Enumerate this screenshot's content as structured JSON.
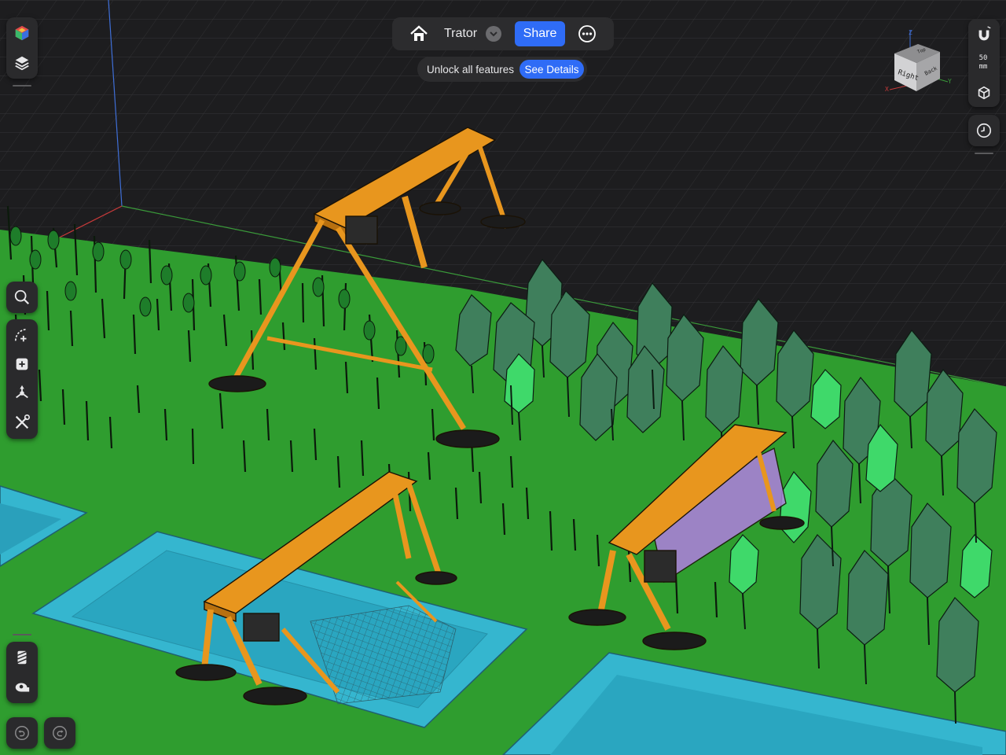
{
  "app": {
    "document_title": "Trator",
    "share_label": "Share",
    "promo_text": "Unlock all features",
    "promo_button": "See Details"
  },
  "view_cube": {
    "faces": {
      "right": "Right",
      "back": "Back",
      "top": "Top"
    },
    "axes": {
      "x": "X",
      "y": "Y",
      "z": "Z"
    }
  },
  "snap": {
    "value": "50",
    "unit": "mm"
  },
  "left_toolbar_icons": [
    "material-cube-icon",
    "layers-icon",
    "search-icon",
    "sketch-curve-icon",
    "add-primitive-icon",
    "transform-gizmo-icon",
    "tools-icon",
    "section-view-icon",
    "measure-tape-icon",
    "undo-icon",
    "redo-icon"
  ],
  "right_toolbar_icons": [
    "magnet-snap-icon",
    "snap-cube-icon",
    "history-clock-icon"
  ],
  "colors": {
    "background": "#1d1d1f",
    "ground": "#2f9d2f",
    "water": "#35b6cf",
    "crane": "#e8961e",
    "tree_dark": "#3f7f5c",
    "accent": "#2f6cf6"
  }
}
